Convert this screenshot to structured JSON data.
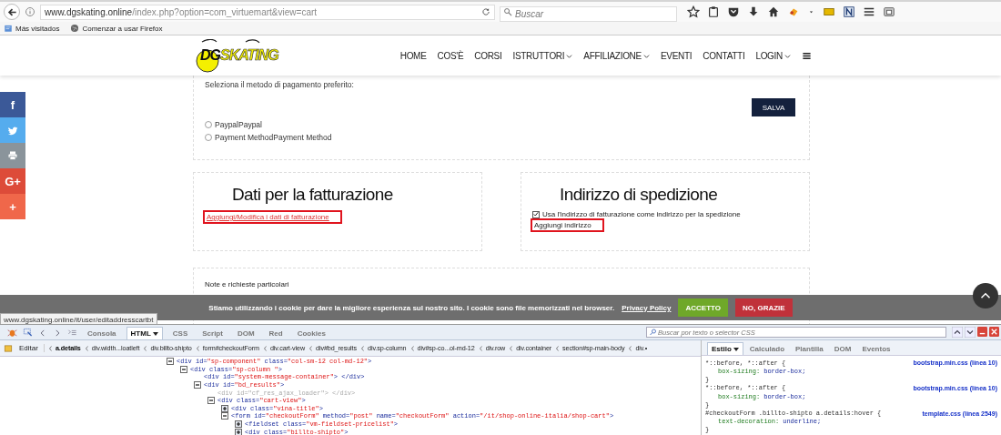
{
  "browser": {
    "url_domain": "www.dgskating.online",
    "url_path": "/index.php?option=com_virtuemart&view=cart",
    "search_placeholder": "Buscar",
    "bookmarks": [
      "Más visitados",
      "Comenzar a usar Firefox"
    ]
  },
  "site": {
    "logo": [
      "DG",
      "SKATING"
    ],
    "nav": [
      {
        "label": "HOME",
        "has_menu": false
      },
      {
        "label": "COS'È",
        "has_menu": false
      },
      {
        "label": "CORSI",
        "has_menu": false
      },
      {
        "label": "ISTRUTTORI",
        "has_menu": true
      },
      {
        "label": "AFFILIAZIONE",
        "has_menu": true
      },
      {
        "label": "EVENTI",
        "has_menu": false
      },
      {
        "label": "CONTATTI",
        "has_menu": false
      },
      {
        "label": "LOGIN",
        "has_menu": true
      }
    ]
  },
  "social": [
    {
      "kind": "facebook",
      "label": "f",
      "color": "#3b5998"
    },
    {
      "kind": "twitter",
      "color": "#55acee"
    },
    {
      "kind": "print",
      "color": "#8a949b"
    },
    {
      "kind": "google",
      "label": "G+",
      "color": "#dd4b39"
    },
    {
      "kind": "share",
      "label": "+",
      "color": "#f0674a"
    }
  ],
  "payment": {
    "prompt": "Seleziona il metodo di pagamento preferito:",
    "save_button": "SALVA",
    "options": [
      {
        "label": "PaypalPaypal",
        "selected": false
      },
      {
        "label": "Payment MethodPayment Method",
        "selected": false
      }
    ]
  },
  "billing": {
    "title": "Dati per la fatturazione",
    "link": "Aggiungi/Modifica i dati di fatturazione",
    "highlighted": true
  },
  "shipping": {
    "title": "Indirizzo di spedizione",
    "checkbox": {
      "label": "Usa l'indirizzo di fatturazione come indirizzo per la spedizione",
      "checked": true
    },
    "link": "Aggiungi indirizzo",
    "highlighted": true
  },
  "notes": {
    "label": "Note e richieste particolari"
  },
  "cookie_bar": {
    "text": "Stiamo utilizzando i cookie per dare la migliore esperienza sul nostro sito. I cookie sono file memorizzati nel browser.",
    "link": "Privacy Policy",
    "accept": "ACCETTO",
    "decline": "NO, GRAZIE"
  },
  "status_url": "www.dgskating.online/it/user/editaddresscartbt",
  "devtools": {
    "tabs": [
      {
        "label": "Consola",
        "selected": false
      },
      {
        "label": "HTML",
        "selected": true
      },
      {
        "label": "CSS",
        "selected": false
      },
      {
        "label": "Script",
        "selected": false
      },
      {
        "label": "DOM",
        "selected": false
      },
      {
        "label": "Red",
        "selected": false
      },
      {
        "label": "Cookies",
        "selected": false
      }
    ],
    "search_placeholder": "Buscar por texto o selector CSS",
    "edit_button": "Editar",
    "breadcrumbs": [
      {
        "label": "a.details",
        "selected": true
      },
      {
        "label": "div.width...loatleft",
        "selected": false
      },
      {
        "label": "div.billto-shipto",
        "selected": false
      },
      {
        "label": "form#checkoutForm",
        "selected": false
      },
      {
        "label": "div.cart-view",
        "selected": false
      },
      {
        "label": "div#bd_results",
        "selected": false
      },
      {
        "label": "div.sp-column",
        "selected": false
      },
      {
        "label": "div#sp-co...ol-md-12",
        "selected": false
      },
      {
        "label": "div.row",
        "selected": false
      },
      {
        "label": "div.container",
        "selected": false
      },
      {
        "label": "section#sp-main-body",
        "selected": false
      },
      {
        "label": "div.•",
        "selected": false
      }
    ],
    "html_tree": [
      {
        "segments": [
          "<div id=",
          "\"sp-component\"",
          " class=",
          "\"col-sm-12 col-md-12\"",
          ">"
        ],
        "expanded": true,
        "children": [
          {
            "segments": [
              "<div class=",
              "\"sp-column \"",
              ">"
            ],
            "expanded": true,
            "children": [
              {
                "segments": [
                  "<div id=",
                  "\"system-message-container\"",
                  ">  </div>"
                ]
              },
              {
                "segments": [
                  "<div id=",
                  "\"bd_results\"",
                  ">"
                ],
                "expanded": true,
                "children": [
                  {
                    "segments": [
                      "<div id=",
                      "\"cf_res_ajax_loader\"",
                      "> </div>"
                    ],
                    "hidden": true
                  },
                  {
                    "segments": [
                      "<div class=",
                      "\"cart-view\"",
                      ">"
                    ],
                    "expanded": true,
                    "children": [
                      {
                        "segments": [
                          "<div class=",
                          "\"vina-title\"",
                          ">"
                        ],
                        "expanded": false
                      },
                      {
                        "segments": [
                          "<form id=",
                          "\"checkoutForm\"",
                          " method=",
                          "\"post\"",
                          " name=",
                          "\"checkoutForm\"",
                          " action=",
                          "\"/it/shop-online-italia/shop-cart\"",
                          ">"
                        ],
                        "expanded": true,
                        "children": [
                          {
                            "segments": [
                              "<fieldset class=",
                              "\"vm-fieldset-pricelist\"",
                              ">"
                            ],
                            "expanded": false
                          },
                          {
                            "segments": [
                              "<div class=",
                              "\"billto-shipto\"",
                              ">"
                            ],
                            "expanded": false
                          }
                        ]
                      }
                    ]
                  }
                ]
              }
            ]
          }
        ]
      }
    ],
    "style_tabs": [
      {
        "label": "Estilo",
        "selected": true
      },
      {
        "label": "Calculado",
        "selected": false
      },
      {
        "label": "Plantilla",
        "selected": false
      },
      {
        "label": "DOM",
        "selected": false
      },
      {
        "label": "Eventos",
        "selected": false
      }
    ],
    "rules": [
      {
        "open": "*::before, *::after {",
        "source": "bootstrap.min.css (línea 10)",
        "props": [
          {
            "name": "box-sizing:",
            "value": "border-box;"
          }
        ],
        "close": "}"
      },
      {
        "open": "*::before, *::after {",
        "source": "bootstrap.min.css (línea 10)",
        "props": [
          {
            "name": "box-sizing:",
            "value": "border-box;"
          }
        ],
        "close": "}"
      },
      {
        "open": "#checkoutForm .billto-shipto a.details:hover {",
        "source": "template.css (línea 2549)",
        "props": [
          {
            "name": "text-decoration:",
            "value": "underline;"
          }
        ],
        "close": "}"
      }
    ]
  }
}
